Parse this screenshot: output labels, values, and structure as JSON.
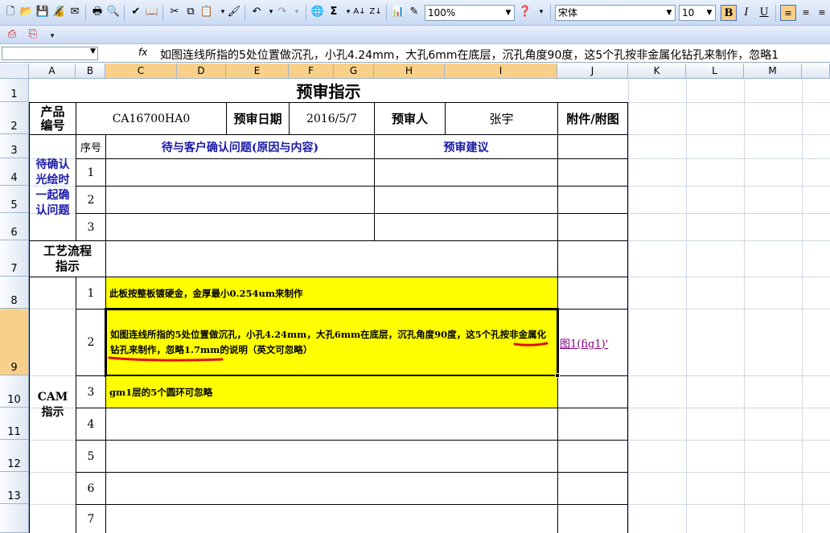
{
  "toolbar": {
    "zoom": "100%",
    "font_name": "宋体",
    "font_size": "10",
    "bold": "B",
    "italic": "I",
    "underline": "U"
  },
  "formula_bar": {
    "fx": "fx",
    "content": "如图连线所指的5处位置做沉孔，小孔4.24mm，大孔6mm在底层，沉孔角度90度，这5个孔按非金属化钻孔来制作，忽略1"
  },
  "columns": [
    "A",
    "B",
    "C",
    "D",
    "E",
    "F",
    "G",
    "H",
    "I",
    "J",
    "K",
    "L",
    "M"
  ],
  "rows": [
    "1",
    "2",
    "3",
    "4",
    "5",
    "6",
    "7",
    "8",
    "9",
    "10",
    "11",
    "12",
    "13"
  ],
  "sheet": {
    "title": "预审指示",
    "product_no_label": "产品\n编号",
    "product_no": "CA16700HA0",
    "review_date_label": "预审日期",
    "review_date": "2016/5/7",
    "reviewer_label": "预审人",
    "reviewer": "张宇",
    "attachment_label": "附件/附图",
    "seq_label": "序号",
    "issue_header": "待与客户确认问题(原因与内容)",
    "suggest_header": "预审建议",
    "confirm_label": "待确认光绘时一起确认问题",
    "confirm_rows": [
      "1",
      "2",
      "3"
    ],
    "process_label": "工艺流程指示",
    "cam_label": "CAM\n指示",
    "cam_items": [
      {
        "no": "1",
        "text": "此板按整板镀硬金，金厚最小0.254um来制作"
      },
      {
        "no": "2",
        "text": "如图连线所指的5处位置做沉孔，小孔4.24mm，大孔6mm在底层，沉孔角度90度，这5个孔按非金属化钻孔来制作，忽略1.7mm的说明（英文可忽略）"
      },
      {
        "no": "3",
        "text": "gm1层的5个圆环可忽略"
      },
      {
        "no": "4",
        "text": ""
      },
      {
        "no": "5",
        "text": ""
      },
      {
        "no": "6",
        "text": ""
      },
      {
        "no": "7",
        "text": ""
      }
    ],
    "figure_link": "图1(fig1)'"
  }
}
